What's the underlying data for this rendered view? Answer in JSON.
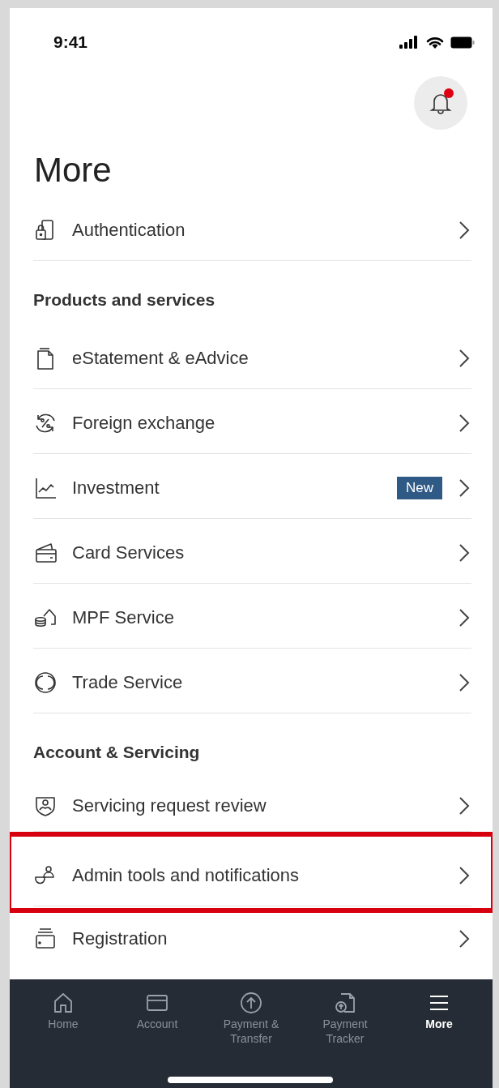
{
  "status_bar": {
    "time": "9:41"
  },
  "notifications": {
    "unread": true
  },
  "title": "More",
  "sections": [
    {
      "items": [
        {
          "label": "Authentication",
          "highlighted": false
        }
      ]
    },
    {
      "heading": "Products and services",
      "items": [
        {
          "label": "eStatement & eAdvice",
          "highlighted": false
        },
        {
          "label": "Foreign exchange",
          "highlighted": false
        },
        {
          "label": "Investment",
          "badge": "New",
          "highlighted": false
        },
        {
          "label": "Card Services",
          "highlighted": false
        },
        {
          "label": "MPF Service",
          "highlighted": false
        },
        {
          "label": "Trade Service",
          "highlighted": false
        }
      ]
    },
    {
      "heading": "Account & Servicing",
      "items": [
        {
          "label": "Servicing request review",
          "highlighted": false
        },
        {
          "label": "Admin tools and notifications",
          "highlighted": true
        },
        {
          "label": "Registration",
          "highlighted": false
        }
      ]
    }
  ],
  "tab_bar": [
    {
      "label": "Home",
      "selected": false
    },
    {
      "label": "Account",
      "selected": false
    },
    {
      "label": "Payment & Transfer",
      "selected": false
    },
    {
      "label": "Payment Tracker",
      "selected": false
    },
    {
      "label": "More",
      "selected": true
    }
  ]
}
